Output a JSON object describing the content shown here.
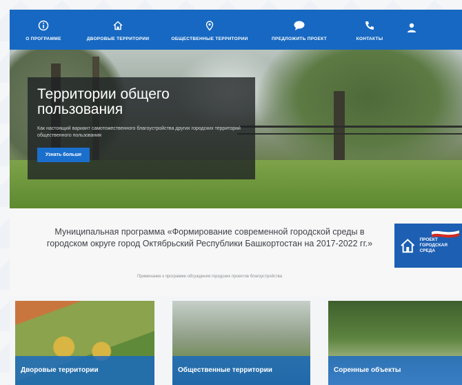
{
  "nav": {
    "items": [
      {
        "label": "О программе",
        "icon": "info-icon"
      },
      {
        "label": "Дворовые территории",
        "icon": "home-icon"
      },
      {
        "label": "Общественные территории",
        "icon": "map-pin-icon"
      },
      {
        "label": "Предложить проект",
        "icon": "chat-bubble-icon"
      },
      {
        "label": "Контакты",
        "icon": "phone-icon"
      },
      {
        "label": "",
        "icon": "user-icon"
      }
    ],
    "color": "#1768c2"
  },
  "hero": {
    "title": "Территории общего пользования",
    "text": "Как настоящий вариант самотожественного благоустройства других городских территорий общественного пользования",
    "button": "Узнать больше"
  },
  "program": {
    "title": "Муниципальная программа «Формирование современной городской среды в городском округе город Октябрьский Республики Башкортостан на 2017-2022 гг.»",
    "subtitle": "Примечание к программе обсуждения городских проектов благоустройства",
    "logo_text": "Проект городская среда"
  },
  "cards": [
    {
      "label": "Дворовые территории"
    },
    {
      "label": "Общественные территории"
    },
    {
      "label": "Соренные объекты"
    }
  ],
  "colors": {
    "accent": "#1768c2",
    "panel": "#1e2124"
  }
}
